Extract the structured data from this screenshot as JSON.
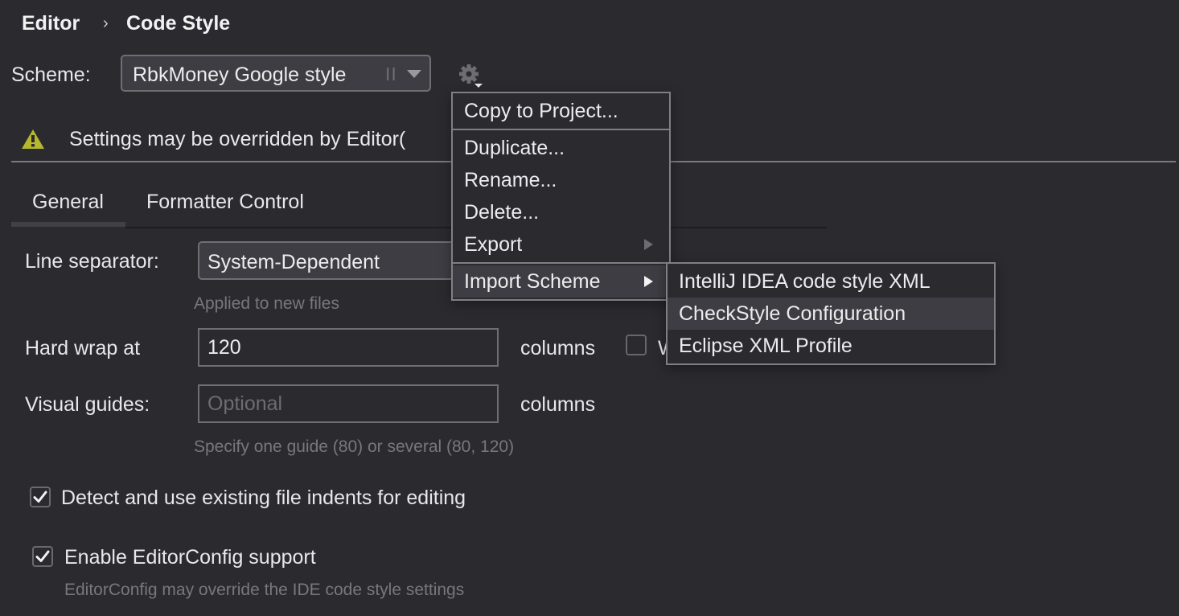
{
  "breadcrumb": {
    "items": [
      "Editor",
      "Code Style"
    ],
    "separator": "›"
  },
  "scheme": {
    "label": "Scheme:",
    "selected": "RbkMoney Google style",
    "scope_flag": "II"
  },
  "warning": {
    "icon": "warning-triangle-icon",
    "text": "Settings may be overridden by Editor(",
    "color": "#b5b82d"
  },
  "tabs": [
    {
      "label": "General",
      "active": true
    },
    {
      "label": "Formatter Control",
      "active": false
    }
  ],
  "line_separator": {
    "label": "Line separator:",
    "selected": "System-Dependent",
    "hint": "Applied to new files"
  },
  "hard_wrap": {
    "label": "Hard wrap at",
    "value": "120",
    "unit": "columns",
    "wrap_on_typing_label": "W",
    "wrap_on_typing_checked": false
  },
  "visual_guides": {
    "label": "Visual guides:",
    "value": "",
    "placeholder": "Optional",
    "unit": "columns",
    "hint": "Specify one guide (80) or several (80, 120)"
  },
  "detect_indents": {
    "label": "Detect and use existing file indents for editing",
    "checked": true
  },
  "editorconfig": {
    "label": "Enable EditorConfig support",
    "checked": true,
    "hint": "EditorConfig may override the IDE code style settings"
  },
  "gear_menu": {
    "icon": "gear-icon",
    "items": [
      {
        "label": "Copy to Project...",
        "submenu": false
      },
      {
        "label": "Duplicate...",
        "submenu": false
      },
      {
        "label": "Rename...",
        "submenu": false
      },
      {
        "label": "Delete...",
        "submenu": false
      },
      {
        "label": "Export",
        "submenu": true
      },
      {
        "label": "Import Scheme",
        "submenu": true,
        "selected": true
      }
    ]
  },
  "import_submenu": {
    "items": [
      {
        "label": "IntelliJ IDEA code style XML"
      },
      {
        "label": "CheckStyle Configuration",
        "hovered": true
      },
      {
        "label": "Eclipse XML Profile"
      }
    ]
  },
  "colors": {
    "background": "#2b2a2f",
    "control_bg": "#3e3d43",
    "border": "#6f6e73",
    "menu_border": "#807f84",
    "hint_text": "#78787c",
    "warning": "#b5b82d"
  }
}
